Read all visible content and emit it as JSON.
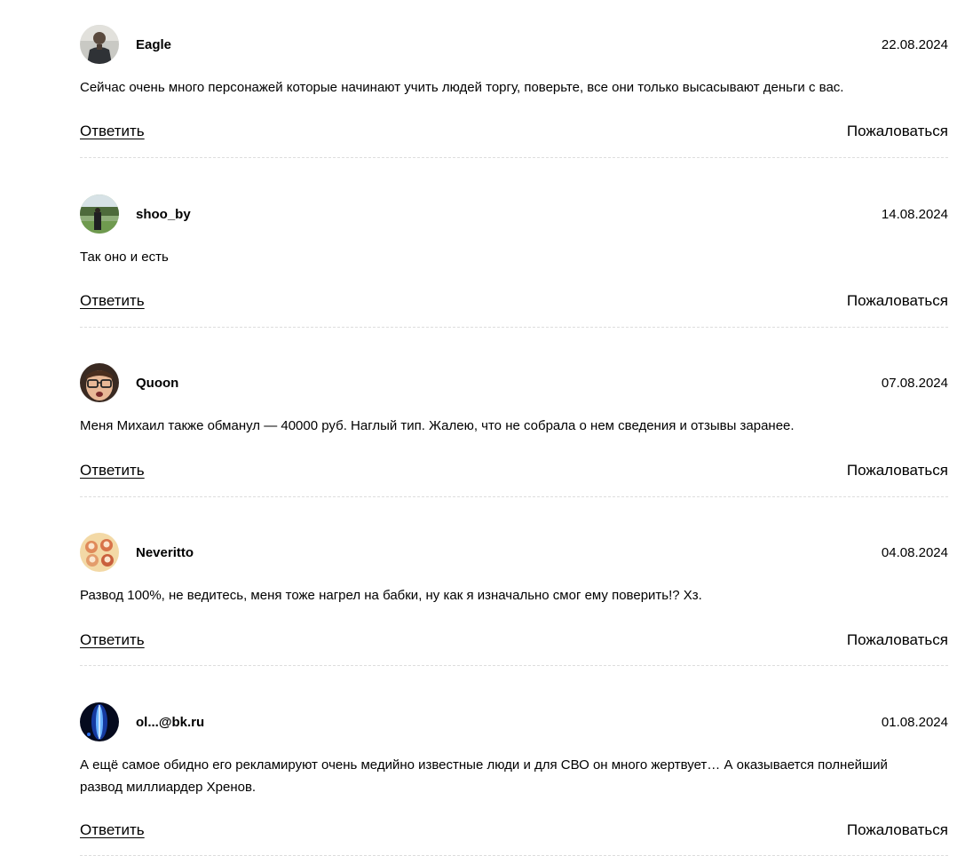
{
  "actions": {
    "reply_label": "Ответить",
    "report_label": "Пожаловаться"
  },
  "comments": [
    {
      "author": "Eagle",
      "date": "22.08.2024",
      "text": "Сейчас очень много персонажей которые начинают учить людей торгу, поверьте, все они только высасывают деньги с вас.",
      "avatar_icon": "avatar-man-photo-icon"
    },
    {
      "author": "shoo_by",
      "date": "14.08.2024",
      "text": "Так оно и есть",
      "avatar_icon": "avatar-landscape-photo-icon"
    },
    {
      "author": "Quoon",
      "date": "07.08.2024",
      "text": "Меня Михаил также обманул — 40000 руб. Наглый тип. Жалею, что не собрала о нем сведения и отзывы заранее.",
      "avatar_icon": "avatar-glasses-face-icon"
    },
    {
      "author": "Neveritto",
      "date": "04.08.2024",
      "text": "Развод 100%, не ведитесь, меня тоже нагрел на бабки, ну как я изначально смог ему поверить!? Хз.",
      "avatar_icon": "avatar-cartoon-group-icon"
    },
    {
      "author": "ol...@bk.ru",
      "date": "01.08.2024",
      "text": "А ещё самое обидно его рекламируют очень медийно известные люди и для СВО он много жертвует… А оказывается полнейший развод миллиардер Хренов.",
      "avatar_icon": "avatar-blue-light-icon"
    }
  ]
}
